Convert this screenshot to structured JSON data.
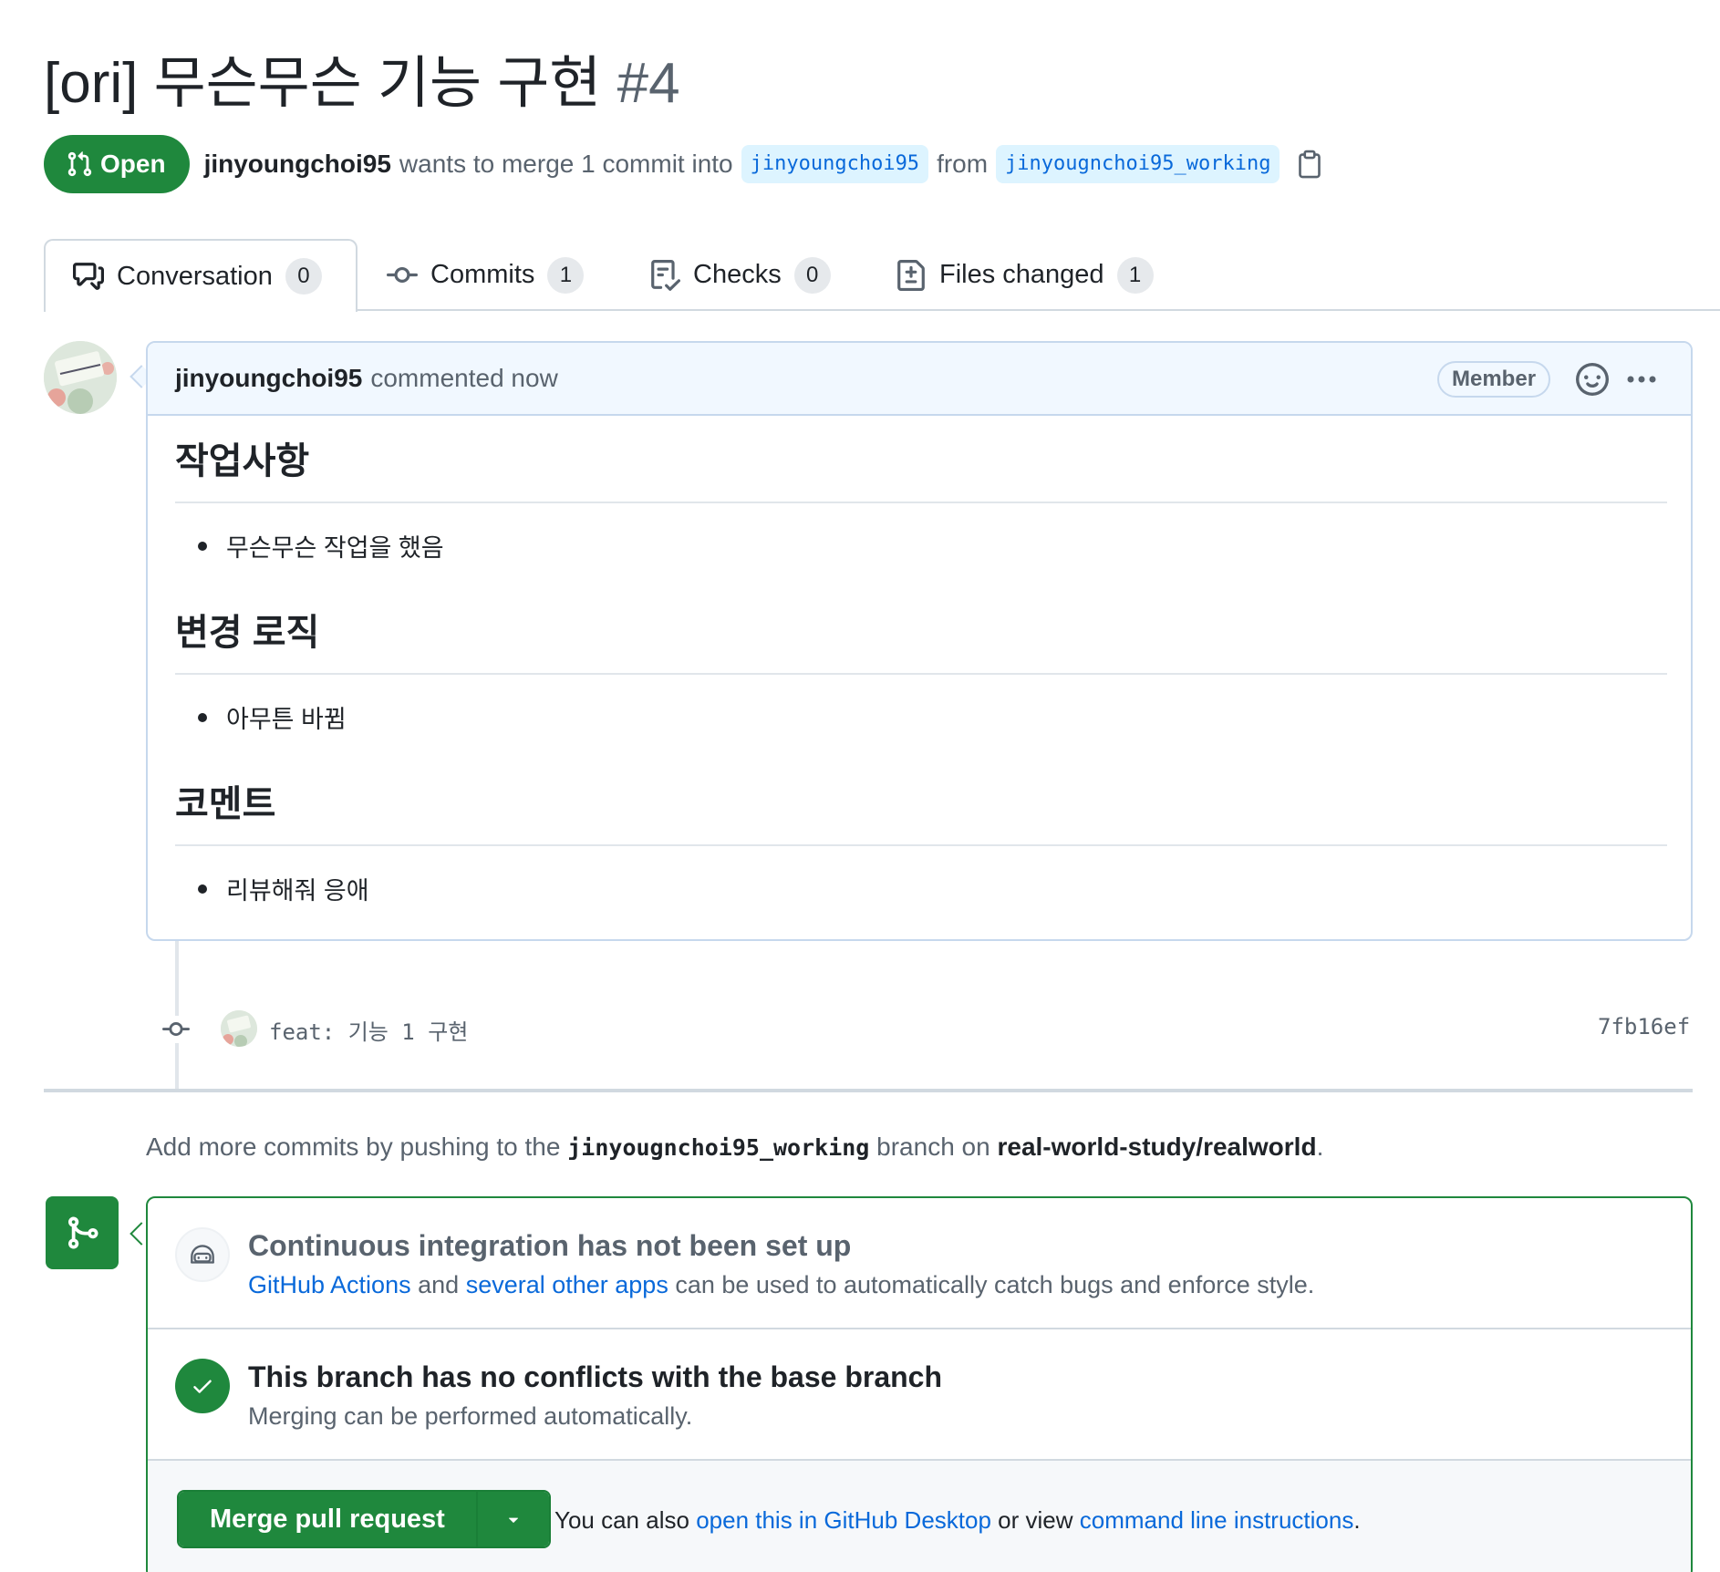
{
  "pr": {
    "title": "[ori] 무슨무슨 기능 구현",
    "number": "#4",
    "state": "Open",
    "author": "jinyoungchoi95",
    "merge_text": "wants to merge 1 commit into",
    "base_branch": "jinyoungchoi95",
    "from_text": "from",
    "head_branch": "jinyougnchoi95_working"
  },
  "tabs": [
    {
      "label": "Conversation",
      "count": "0",
      "icon": "comment-discussion-icon"
    },
    {
      "label": "Commits",
      "count": "1",
      "icon": "git-commit-icon"
    },
    {
      "label": "Checks",
      "count": "0",
      "icon": "checklist-icon"
    },
    {
      "label": "Files changed",
      "count": "1",
      "icon": "file-diff-icon"
    }
  ],
  "comment": {
    "author": "jinyoungchoi95",
    "action": "commented now",
    "badge": "Member",
    "sections": [
      {
        "heading": "작업사항",
        "item": "무슨무슨 작업을 했음"
      },
      {
        "heading": "변경 로직",
        "item": "아무튼 바뀜"
      },
      {
        "heading": "코멘트",
        "item": "리뷰해줘 응애"
      }
    ]
  },
  "commit": {
    "message": "feat: 기능 1 구현",
    "sha": "7fb16ef"
  },
  "push_hint": {
    "prefix": "Add more commits by pushing to the",
    "branch": "jinyougnchoi95_working",
    "middle": "branch on",
    "repo": "real-world-study/realworld",
    "suffix": "."
  },
  "merge_box": {
    "ci_title": "Continuous integration has not been set up",
    "ci_link1": "GitHub Actions",
    "ci_and": "and",
    "ci_link2": "several other apps",
    "ci_rest": "can be used to automatically catch bugs and enforce style.",
    "conflict_title": "This branch has no conflicts with the base branch",
    "conflict_desc": "Merging can be performed automatically.",
    "merge_button": "Merge pull request",
    "alt_prefix": "You can also",
    "alt_link1": "open this in GitHub Desktop",
    "alt_middle": "or view",
    "alt_link2": "command line instructions",
    "alt_suffix": "."
  },
  "colors": {
    "accent_green": "#1f883d",
    "link_blue": "#0969da",
    "muted_text": "#59636e"
  }
}
